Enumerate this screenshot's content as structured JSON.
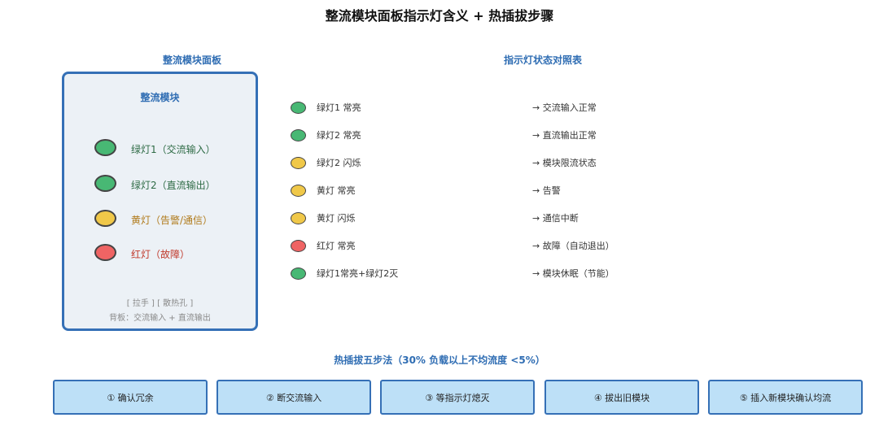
{
  "title": "整流模块面板指示灯含义 + 热插拔步骤",
  "panel": {
    "heading": "整流模块面板",
    "title": "整流模块",
    "leds": [
      {
        "label": "绿灯1（交流输入）",
        "color": "#48b874",
        "text_color": "#2e6b45"
      },
      {
        "label": "绿灯2（直流输出）",
        "color": "#48b874",
        "text_color": "#2e6b45"
      },
      {
        "label": "黄灯（告警/通信）",
        "color": "#f0c849",
        "text_color": "#b07a1a"
      },
      {
        "label": "红灯（故障）",
        "color": "#ef6464",
        "text_color": "#c0392b"
      }
    ],
    "foot_line1": "[ 拉手 ] [ 散热孔 ]",
    "foot_line2": "背板：交流输入 + 直流输出"
  },
  "table": {
    "heading": "指示灯状态对照表",
    "rows": [
      {
        "state": "绿灯1 常亮",
        "meaning": "→  交流输入正常",
        "color": "#48b874"
      },
      {
        "state": "绿灯2 常亮",
        "meaning": "→  直流输出正常",
        "color": "#48b874"
      },
      {
        "state": "绿灯2 闪烁",
        "meaning": "→  模块限流状态",
        "color": "#f0c849"
      },
      {
        "state": "黄灯 常亮",
        "meaning": "→  告警",
        "color": "#f0c849"
      },
      {
        "state": "黄灯 闪烁",
        "meaning": "→  通信中断",
        "color": "#f0c849"
      },
      {
        "state": "红灯 常亮",
        "meaning": "→  故障（自动退出）",
        "color": "#ef6464"
      },
      {
        "state": "绿灯1常亮+绿灯2灭",
        "meaning": "→  模块休眠（节能）",
        "color": "#48b874"
      }
    ]
  },
  "steps": {
    "heading": "热插拔五步法（30% 负载以上不均流度 <5%）",
    "items": [
      "① 确认冗余",
      "② 断交流输入",
      "③ 等指示灯熄灭",
      "④ 拔出旧模块",
      "⑤ 插入新模块确认均流"
    ]
  }
}
